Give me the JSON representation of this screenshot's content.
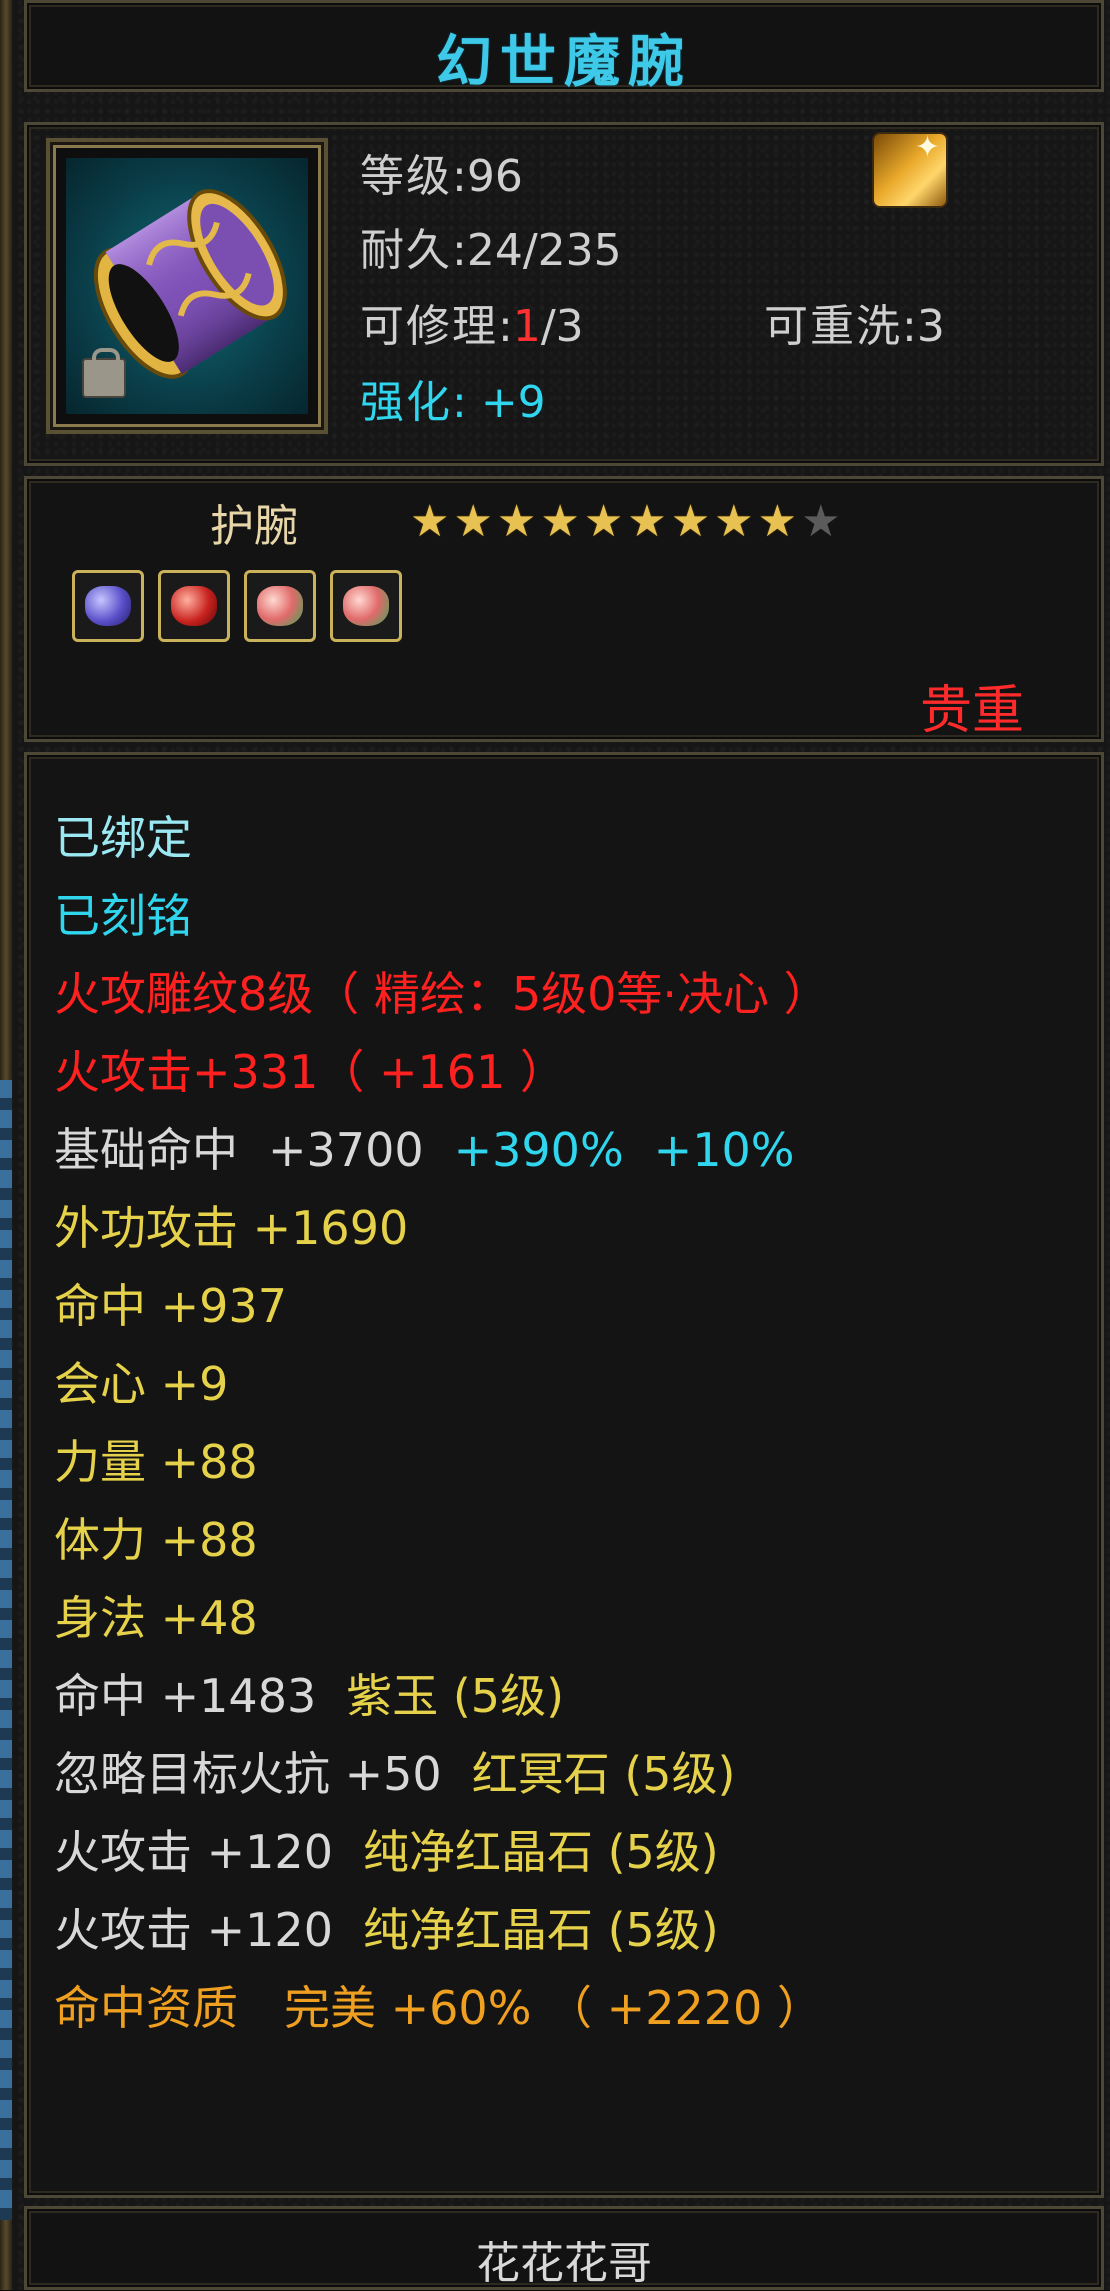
{
  "title": "幻世魔腕",
  "item": {
    "level_label": "等级",
    "level_value": "96",
    "durability_label": "耐久",
    "durability_value": "24/235",
    "repair_label": "可修理",
    "repair_used": "1",
    "repair_total": "/3",
    "rewash_label": "可重洗",
    "rewash_value": "3",
    "enhance_label": "强化",
    "enhance_value": "+9"
  },
  "type_label": "护腕",
  "stars": {
    "filled": 9,
    "total": 10
  },
  "gems": [
    "purple",
    "red",
    "pink",
    "pink"
  ],
  "precious_label": "贵重",
  "attributes": {
    "bound": "已绑定",
    "engraved": "已刻铭",
    "carving": "火攻雕纹8级（ 精绘：5级0等·决心 ）",
    "fire_attack": "火攻击+331（ +161 ）",
    "base_hit_label": "基础命中",
    "base_hit_value": "+3700",
    "base_hit_pct1": "+390%",
    "base_hit_pct2": "+10%",
    "outer_attack": "外功攻击 +1690",
    "hit": "命中 +937",
    "crit": "会心 +9",
    "strength": "力量 +88",
    "stamina": "体力 +88",
    "agility": "身法 +48",
    "gem1_stat": "命中 +1483",
    "gem1_name": "紫玉 (5级)",
    "gem2_stat": "忽略目标火抗 +50",
    "gem2_name": "红冥石 (5级)",
    "gem3_stat": "火攻击 +120",
    "gem3_name": "纯净红晶石 (5级)",
    "gem4_stat": "火攻击 +120",
    "gem4_name": "纯净红晶石 (5级)",
    "aptitude": "命中资质　完美 +60% （ +2220 ）"
  },
  "footer_name": "花花花哥",
  "colors": {
    "title": "#3fc9e8",
    "precious": "#ff2b2b",
    "gold": "#e6d24a",
    "orange": "#f0a020"
  }
}
